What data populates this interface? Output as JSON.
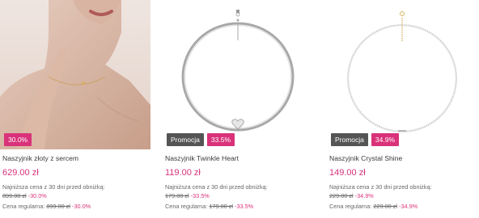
{
  "products": [
    {
      "title": "Naszyjnik złoty z sercem",
      "price": "629.00 zł",
      "promo_badge": "",
      "discount_badge": "30.0%",
      "lowest_label": "Najniższa cena z 30 dni przed obniżką:",
      "lowest_price": "899.00 zł",
      "lowest_pct": "-30.0%",
      "regular_label": "Cena regularna:",
      "regular_price": "899.00 zł",
      "regular_pct": "-30.0%"
    },
    {
      "title": "Naszyjnik Twinkle Heart",
      "price": "119.00 zł",
      "promo_badge": "Promocja",
      "discount_badge": "33.5%",
      "lowest_label": "Najniższa cena z 30 dni przed obniżką:",
      "lowest_price": "179.00 zł",
      "lowest_pct": "-33.5%",
      "regular_label": "Cena regularna:",
      "regular_price": "179.00 zł",
      "regular_pct": "-33.5%"
    },
    {
      "title": "Naszyjnik Crystal Shine",
      "price": "149.00 zł",
      "promo_badge": "Promocja",
      "discount_badge": "34.9%",
      "lowest_label": "Najniższa cena z 30 dni przed obniżką:",
      "lowest_price": "229.00 zł",
      "lowest_pct": "-34.9%",
      "regular_label": "Cena regularna:",
      "regular_price": "229.00 zł",
      "regular_pct": "-34.9%"
    }
  ],
  "colors": {
    "accent": "#d9327a",
    "promo": "#555555"
  }
}
